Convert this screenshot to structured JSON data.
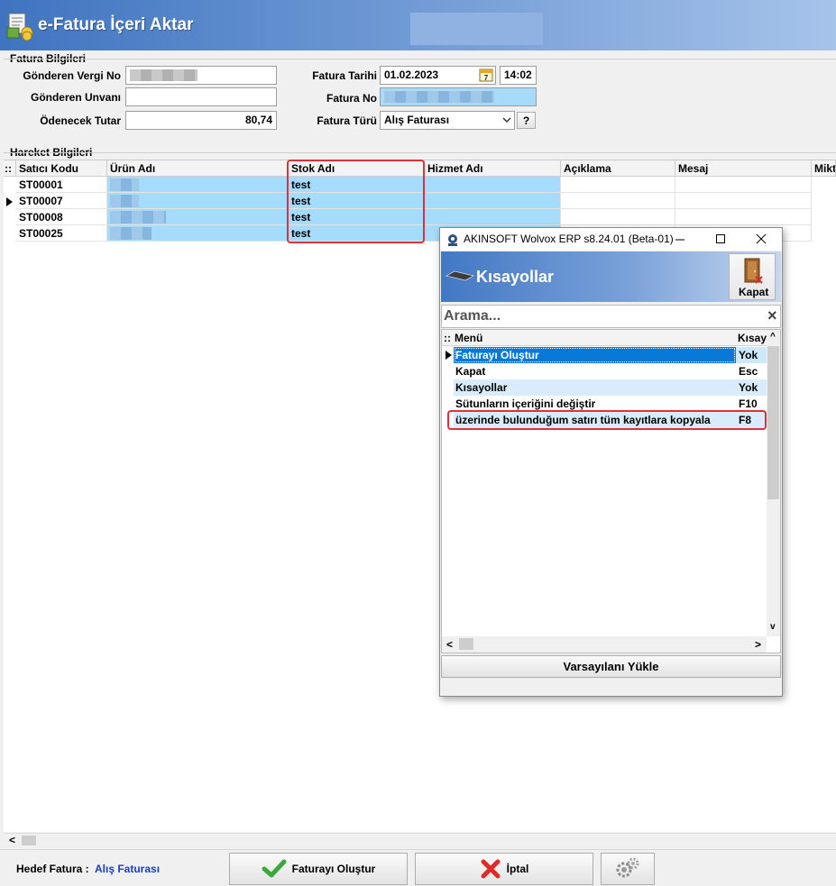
{
  "app": {
    "title": "e-Fatura İçeri Aktar"
  },
  "fatura": {
    "group_label": "Fatura Bilgileri",
    "gonderen_vergi_label": "Gönderen Vergi No",
    "gonderen_unvan_label": "Gönderen Unvanı",
    "odenecek_label": "Ödenecek Tutar",
    "odenecek_value": "80,74",
    "tarih_label": "Fatura Tarihi",
    "tarih_value": "01.02.2023",
    "calendar_day": "7",
    "saat_value": "14:02",
    "no_label": "Fatura No",
    "tur_label": "Fatura Türü",
    "tur_value": "Alış Faturası",
    "help_label": "?"
  },
  "hareket": {
    "group_label": "Hareket Bilgileri",
    "grip": "::",
    "columns": [
      "Satıcı Kodu",
      "Ürün Adı",
      "Stok Adı",
      "Hizmet Adı",
      "Açıklama",
      "Mesaj",
      "Mikt"
    ],
    "rows": [
      {
        "satici": "ST00001",
        "stok": "test"
      },
      {
        "satici": "ST00007",
        "stok": "test"
      },
      {
        "satici": "ST00008",
        "stok": "test"
      },
      {
        "satici": "ST00025",
        "stok": "test"
      }
    ]
  },
  "scroll": {
    "left_arrow": "<"
  },
  "bottom": {
    "hedef_label": "Hedef Fatura :",
    "hedef_value": "Alış Faturası",
    "create_label": "Faturayı Oluştur",
    "cancel_label": "İptal"
  },
  "dialog": {
    "window_title": "AKINSOFT Wolvox ERP s8.24.01 (Beta-01)",
    "banner_title": "Kısayollar",
    "close_tool_label": "Kapat",
    "search_placeholder": "Arama...",
    "clear_icon": "×",
    "grip": "::",
    "col_menu": "Menü",
    "col_key": "Kısayol",
    "items": [
      {
        "menu": "Faturayı Oluştur",
        "key": "Yok"
      },
      {
        "menu": "Kapat",
        "key": "Esc"
      },
      {
        "menu": "Kısayollar",
        "key": "Yok"
      },
      {
        "menu": "Sütunların içeriğini değiştir",
        "key": "F10"
      },
      {
        "menu": "üzerinde bulunduğum satırı tüm kayıtlara kopyala",
        "key": "F8"
      }
    ],
    "scroll_up": "^",
    "scroll_down": "v",
    "scroll_left": "<",
    "scroll_right": ">",
    "default_button": "Varsayılanı Yükle"
  },
  "colors": {
    "selection": "#a6dcfb",
    "highlight_red": "#e0313b",
    "link_blue": "#1a3cc8",
    "title_blue": "#3f74c0"
  }
}
